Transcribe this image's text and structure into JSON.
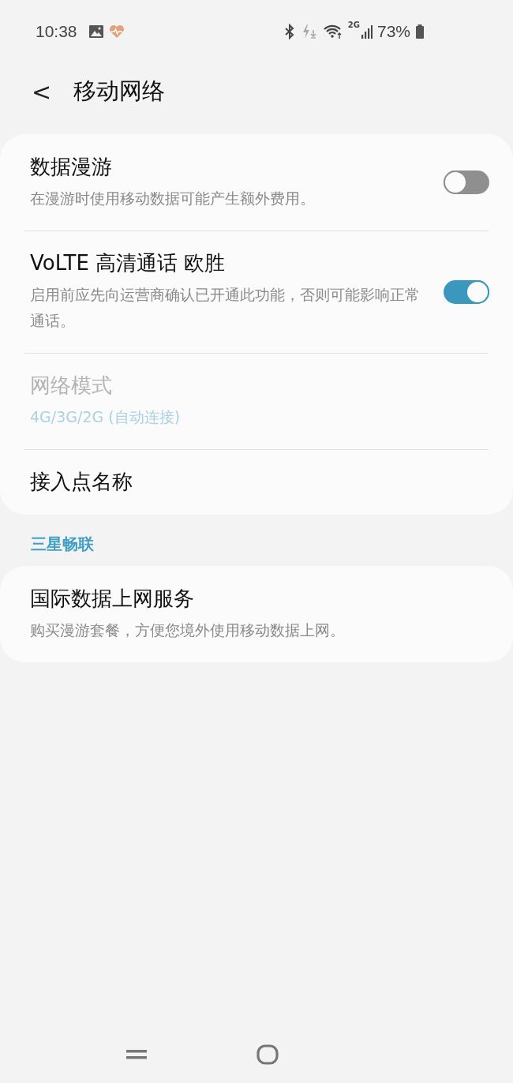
{
  "status_bar": {
    "time": "10:38",
    "network": "2G",
    "battery": "73%"
  },
  "header": {
    "back": "<",
    "title": "移动网络"
  },
  "groups": [
    {
      "items": [
        {
          "kind": "switch",
          "title": "数据漫游",
          "subtitle": "在漫游时使用移动数据可能产生额外费用。",
          "on": false,
          "disabled": false
        },
        {
          "kind": "switch",
          "title": "VoLTE 高清通话 欧胜",
          "subtitle": "启用前应先向运营商确认已开通此功能，否则可能影响正常通话。",
          "on": true,
          "disabled": false
        },
        {
          "kind": "value",
          "title": "网络模式",
          "subtitle": "4G/3G/2G (自动连接)",
          "disabled": true
        },
        {
          "kind": "plain",
          "title": "接入点名称",
          "disabled": false
        }
      ]
    },
    {
      "heading": "三星畅联",
      "items": [
        {
          "kind": "plain",
          "title": "国际数据上网服务",
          "subtitle": "购买漫游套餐，方便您境外使用移动数据上网。",
          "disabled": false
        }
      ]
    }
  ]
}
